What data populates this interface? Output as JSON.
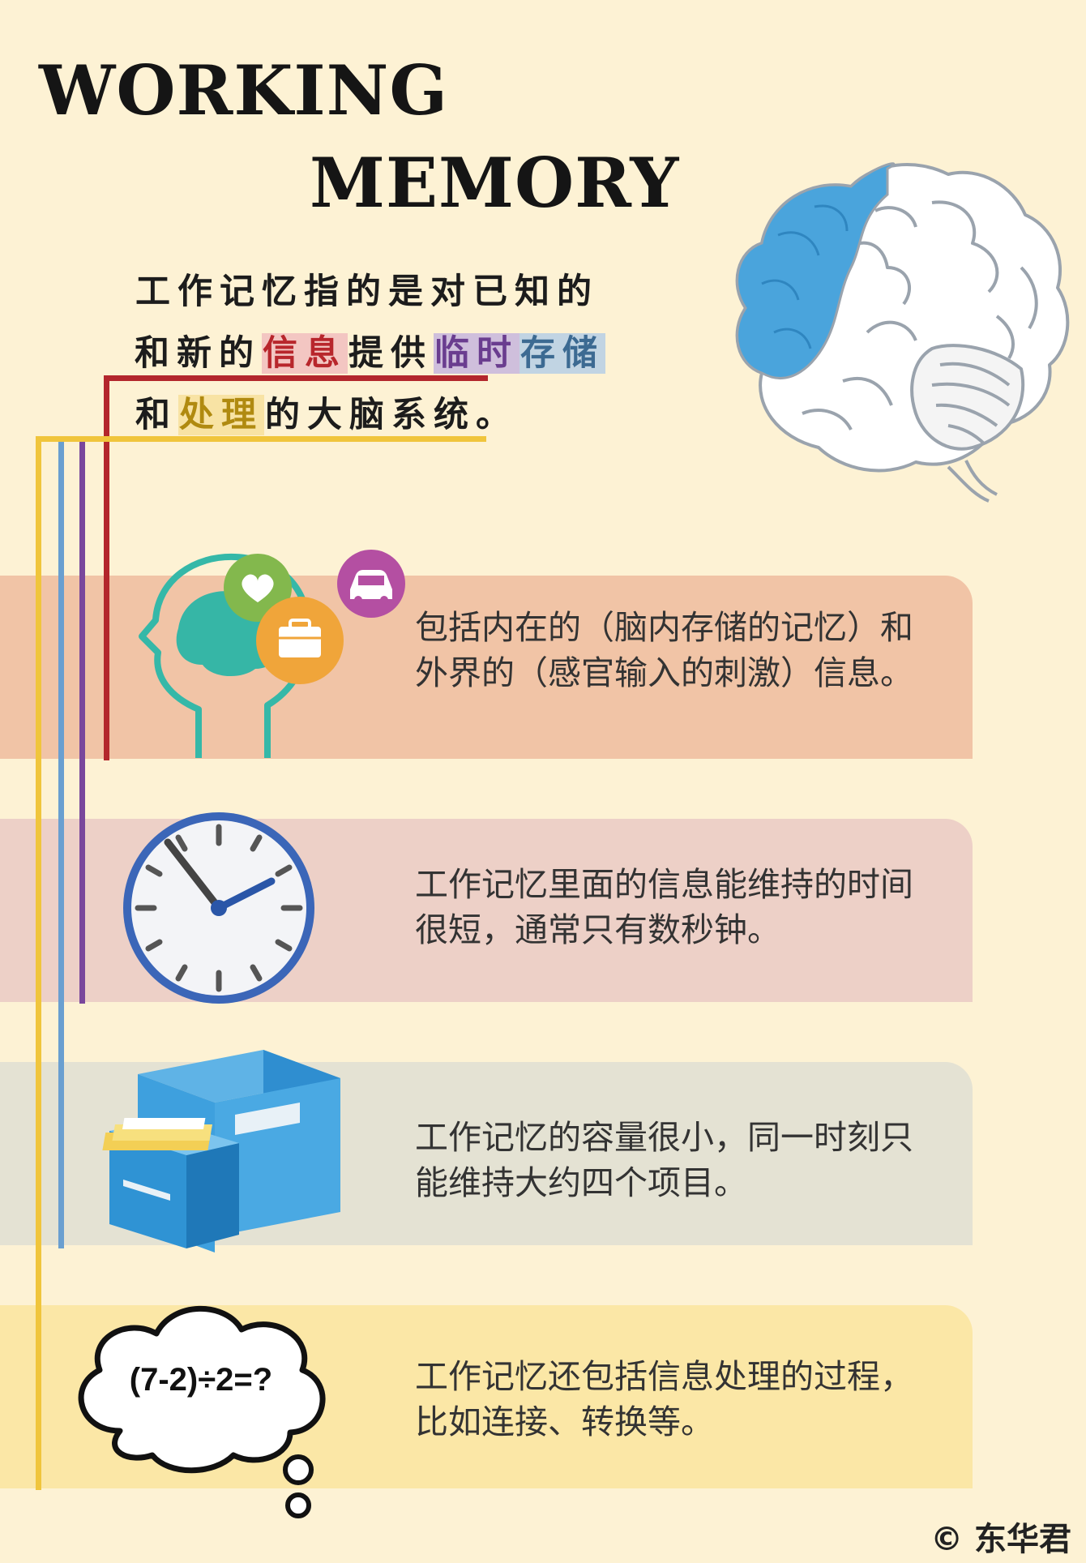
{
  "title": {
    "line1": "WORKING",
    "line2": "MEMORY"
  },
  "intro": {
    "part1": "工作记忆指的是对已知的和新的",
    "info": "信息",
    "part2": "提供",
    "temp": "临时",
    "store": "存储",
    "part3": "和",
    "process": "处理",
    "part4": "的大脑系统。"
  },
  "cards": [
    {
      "text": "包括内在的（脑内存储的记忆）和外界的（感官输入的刺激）信息。",
      "icon": "head-thoughts-icon"
    },
    {
      "text": "工作记忆里面的信息能维持的时间很短，通常只有数秒钟。",
      "icon": "clock-icon"
    },
    {
      "text": "工作记忆的容量很小，同一时刻只能维持大约四个项目。",
      "icon": "filing-cabinet-icon"
    },
    {
      "text": "工作记忆还包括信息处理的过程，比如连接、转换等。",
      "icon": "thought-bubble-icon"
    }
  ],
  "bubble_text": "(7-2)÷2=?",
  "credit": "© 东华君",
  "colors": {
    "info": "#b3262c",
    "temporary": "#7a479c",
    "storage": "#6a9fd0",
    "processing": "#f0c53c",
    "brain_highlight": "#4aa4dc"
  }
}
